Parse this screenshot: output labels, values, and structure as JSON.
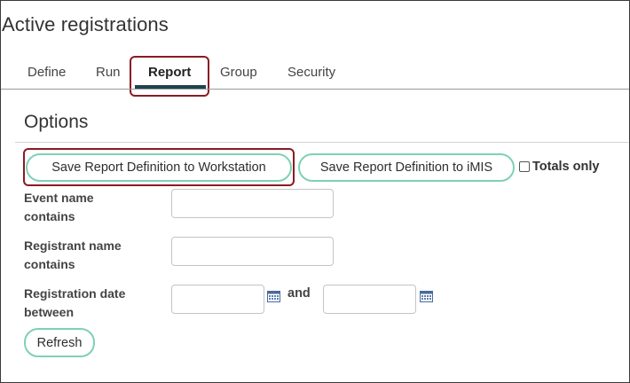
{
  "page": {
    "title": "Active registrations"
  },
  "tabs": [
    {
      "label": "Define",
      "active": false
    },
    {
      "label": "Run",
      "active": false
    },
    {
      "label": "Report",
      "active": true
    },
    {
      "label": "Group",
      "active": false
    },
    {
      "label": "Security",
      "active": false
    }
  ],
  "options": {
    "title": "Options",
    "save_workstation_label": "Save Report Definition to Workstation",
    "save_imis_label": "Save Report Definition to iMIS",
    "totals_only_label": "Totals only",
    "totals_only_checked": false
  },
  "fields": {
    "event_name": {
      "label_line1": "Event name",
      "label_line2": "contains",
      "value": ""
    },
    "registrant_name": {
      "label_line1": "Registrant name",
      "label_line2": "contains",
      "value": ""
    },
    "registration_date": {
      "label_line1": "Registration date",
      "label_line2": "between",
      "from_value": "",
      "and_label": "and",
      "to_value": ""
    }
  },
  "refresh_label": "Refresh",
  "colors": {
    "accent_border": "#7fd1b3",
    "highlight": "#8b1a24",
    "tab_underline": "#1e4450"
  },
  "icons": {
    "date_picker": "calendar-icon"
  }
}
